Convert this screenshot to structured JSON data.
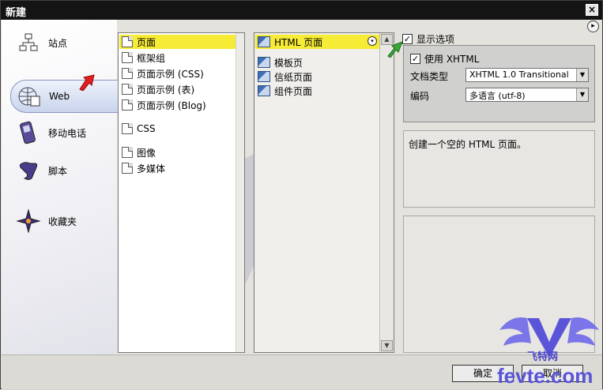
{
  "dialog": {
    "title": "新建",
    "close_label": "×",
    "help_label": "▸"
  },
  "categories": [
    {
      "label": "站点",
      "icon": "site-icon"
    },
    {
      "label": "Web",
      "icon": "web-icon",
      "selected": true
    },
    {
      "label": "移动电话",
      "icon": "mobile-phone-icon"
    },
    {
      "label": "脚本",
      "icon": "script-icon"
    },
    {
      "label": "收藏夹",
      "icon": "favorites-star-icon"
    }
  ],
  "types": [
    "页面",
    "框架组",
    "页面示例 (CSS)",
    "页面示例 (表)",
    "页面示例 (Blog)",
    "CSS",
    "图像",
    "多媒体"
  ],
  "templates": [
    "HTML 页面",
    "模板页",
    "信纸页面",
    "组件页面"
  ],
  "options": {
    "show_options": "显示选项",
    "use_xhtml": "使用 XHTML",
    "doc_type_label": "文档类型",
    "doc_type_value": "XHTML 1.0 Transitional",
    "encoding_label": "编码",
    "encoding_value": "多语言 (utf-8)"
  },
  "description": "创建一个空的 HTML 页面。",
  "buttons": {
    "ok": "确定",
    "cancel": "取消"
  },
  "watermark": {
    "brand": "飞特网",
    "site": "fevte.com"
  },
  "colors": {
    "selection": "#f6ec35",
    "titlebar": "#141414"
  }
}
